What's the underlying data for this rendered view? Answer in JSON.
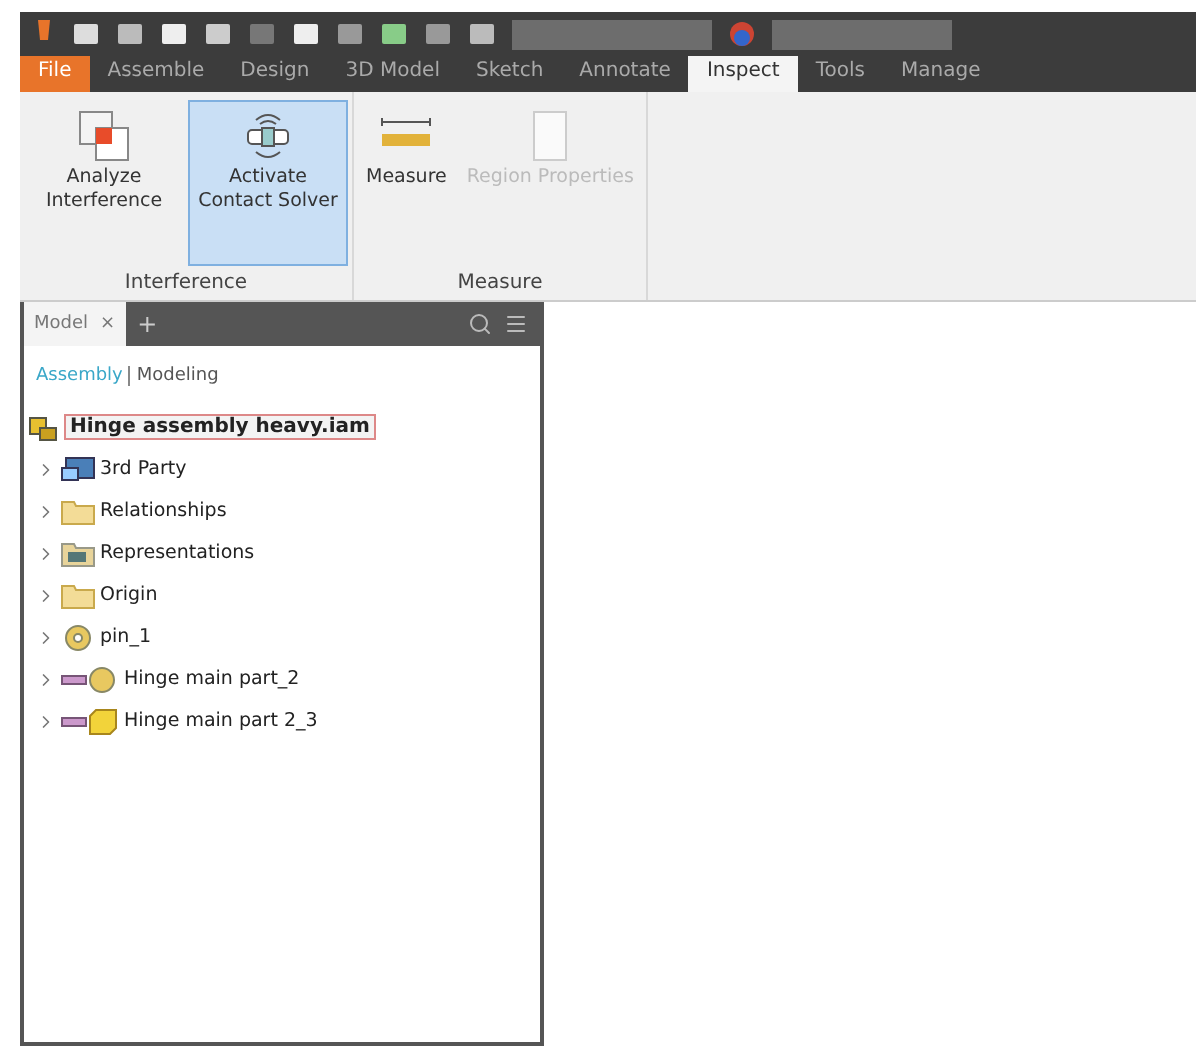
{
  "ribbon_tabs": [
    {
      "label": "File",
      "kind": "file",
      "selected": false
    },
    {
      "label": "Assemble",
      "kind": "tab",
      "selected": false
    },
    {
      "label": "Design",
      "kind": "tab",
      "selected": false
    },
    {
      "label": "3D Model",
      "kind": "tab",
      "selected": false
    },
    {
      "label": "Sketch",
      "kind": "tab",
      "selected": false
    },
    {
      "label": "Annotate",
      "kind": "tab",
      "selected": false
    },
    {
      "label": "Inspect",
      "kind": "tab",
      "selected": true
    },
    {
      "label": "Tools",
      "kind": "tab",
      "selected": false
    },
    {
      "label": "Manage",
      "kind": "tab",
      "selected": false
    }
  ],
  "ribbon_panels": [
    {
      "label": "Interference",
      "commands": [
        {
          "label": "Analyze Interference",
          "kind": "interference",
          "selected": false,
          "disabled": false
        },
        {
          "label": "Activate Contact Solver",
          "kind": "solver",
          "selected": true,
          "disabled": false
        }
      ]
    },
    {
      "label": "Measure",
      "commands": [
        {
          "label": "Measure",
          "kind": "measure",
          "selected": false,
          "disabled": false
        },
        {
          "label": "Region Properties",
          "kind": "region",
          "selected": false,
          "disabled": true
        }
      ]
    }
  ],
  "browser": {
    "tab": "Model",
    "close": "×",
    "add": "+",
    "modes": [
      {
        "label": "Assembly",
        "selected": true
      },
      {
        "label": "Modeling",
        "selected": false
      }
    ],
    "root": {
      "label": "Hinge assembly heavy.iam",
      "selected": true
    },
    "items": [
      {
        "label": "3rd Party",
        "kind": "thirdparty",
        "expanded": false
      },
      {
        "label": "Relationships",
        "kind": "folder",
        "expanded": false
      },
      {
        "label": "Representations",
        "kind": "representations",
        "expanded": false
      },
      {
        "label": "Origin",
        "kind": "folder",
        "expanded": false
      },
      {
        "label": "pin_1",
        "kind": "part",
        "expanded": false
      },
      {
        "label": "Hinge main part_2",
        "kind": "jointpart",
        "expanded": false
      },
      {
        "label": "Hinge main part 2_3",
        "kind": "jointblock",
        "expanded": false
      }
    ]
  }
}
